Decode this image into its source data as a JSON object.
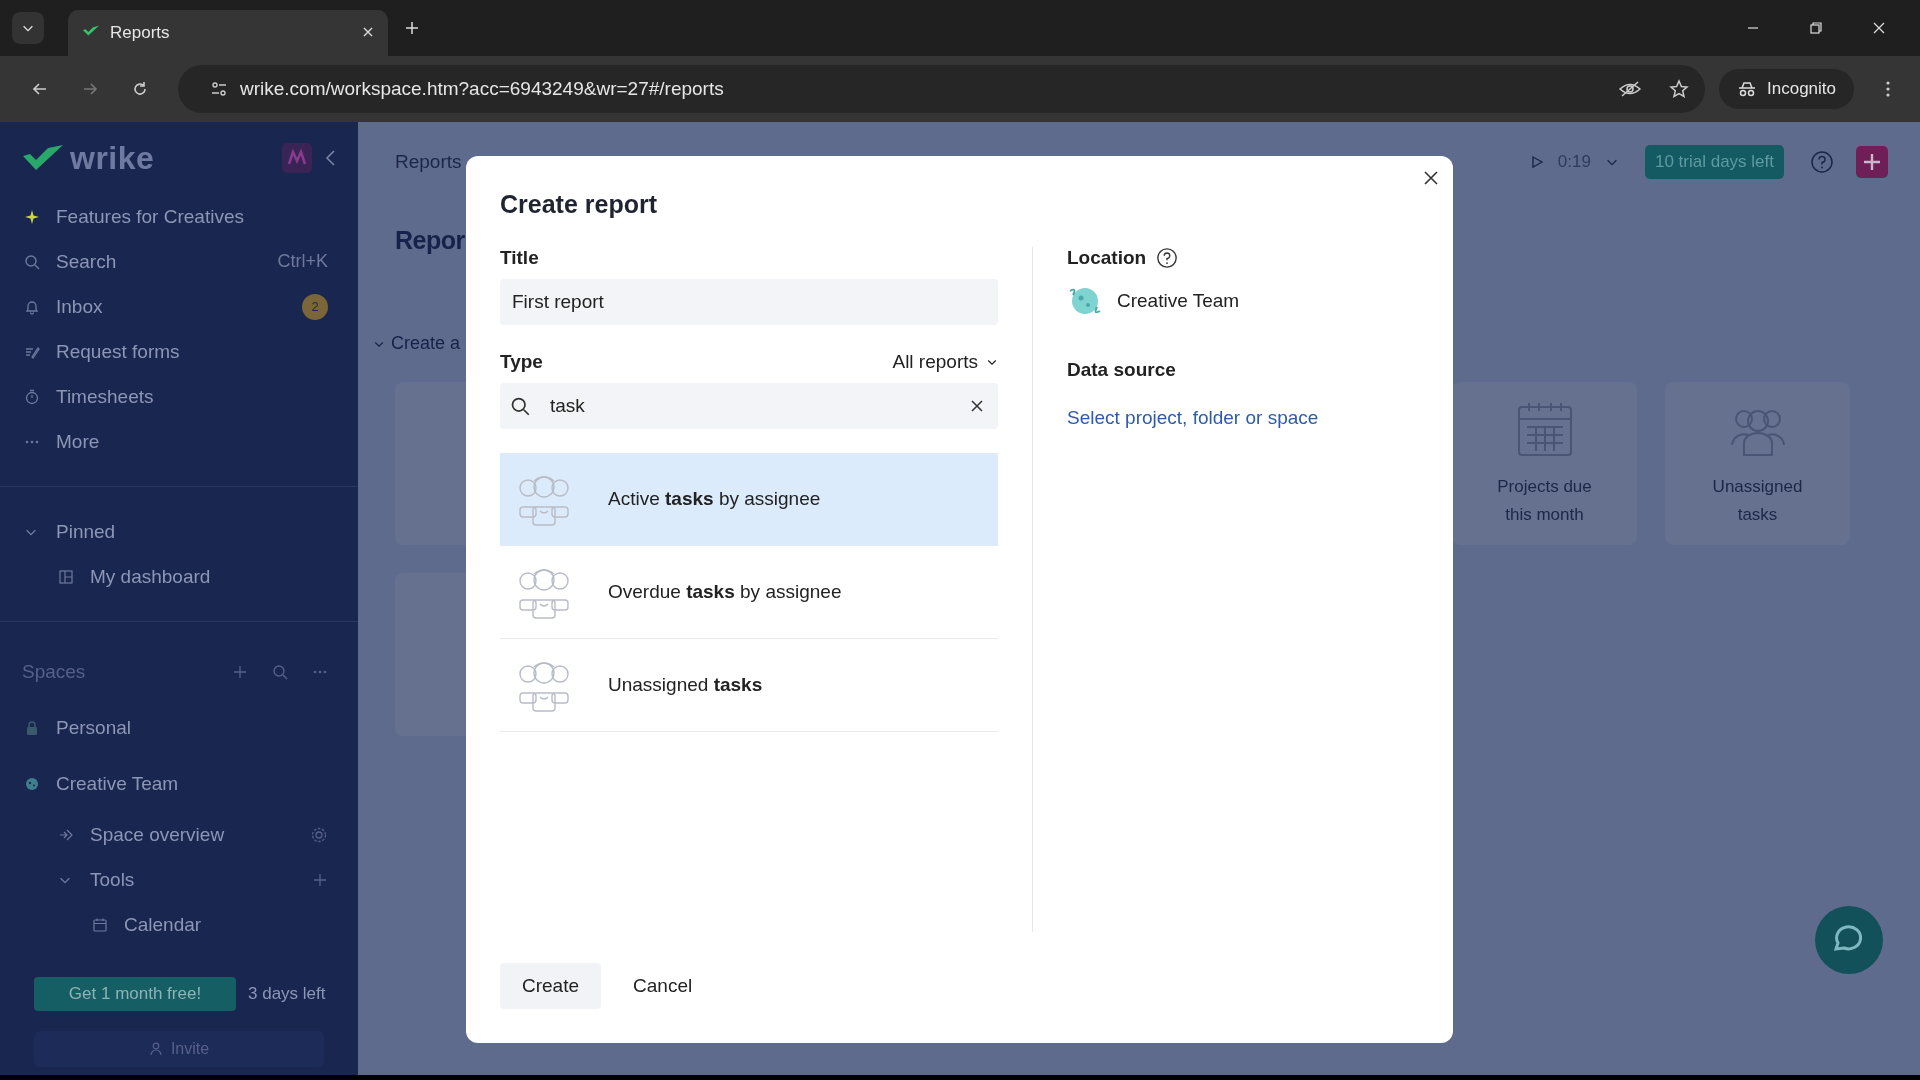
{
  "browser": {
    "tab": {
      "title": "Reports"
    },
    "url": "wrike.com/workspace.htm?acc=6943249&wr=27#/reports",
    "profile": "Incognito"
  },
  "sidebar": {
    "logo": "wrike",
    "nav": [
      {
        "kind": "sparkle",
        "label": "Features for Creatives"
      },
      {
        "kind": "search",
        "label": "Search",
        "shortcut": "Ctrl+K"
      },
      {
        "kind": "bell",
        "label": "Inbox",
        "badge": "2"
      },
      {
        "kind": "form",
        "label": "Request forms"
      },
      {
        "kind": "timer",
        "label": "Timesheets"
      },
      {
        "kind": "dots",
        "label": "More"
      }
    ],
    "pinned": {
      "label": "Pinned",
      "expanded": true,
      "items": [
        {
          "kind": "dashboard",
          "label": "My dashboard"
        }
      ]
    },
    "spaces": {
      "label": "Spaces",
      "items": [
        {
          "kind": "lock",
          "label": "Personal"
        },
        {
          "kind": "planet",
          "label": "Creative Team",
          "children": [
            {
              "kind": "overview",
              "label": "Space overview"
            },
            {
              "kind": "folder",
              "label": "Tools",
              "expanded": true,
              "children": [
                {
                  "kind": "calendar",
                  "label": "Calendar"
                }
              ]
            }
          ]
        }
      ]
    },
    "promo": {
      "button": "Get 1 month free!",
      "note": "3 days left"
    },
    "invite": "Invite"
  },
  "header": {
    "breadcrumb": "Reports",
    "timer": "0:19",
    "trial": "10 trial days left"
  },
  "page": {
    "heading": "Repor",
    "section": "Create a",
    "cards": [
      {
        "kind": "calendar",
        "label": "Projects due this month"
      },
      {
        "kind": "people",
        "label": "Unassigned tasks"
      }
    ]
  },
  "dialog": {
    "title": "Create report",
    "title_label": "Title",
    "title_value": "First report",
    "type_label": "Type",
    "filter": "All reports",
    "search_value": "task",
    "report_types": [
      {
        "label": "Active **tasks** by assignee",
        "selected": true
      },
      {
        "label": "Overdue **tasks** by assignee",
        "selected": false
      },
      {
        "label": "Unassigned **tasks**",
        "selected": false
      }
    ],
    "location_label": "Location",
    "location": "Creative Team",
    "data_source_label": "Data source",
    "data_source_link": "Select project, folder or space",
    "buttons": [
      {
        "label": "Create",
        "kind": "primary"
      },
      {
        "label": "Cancel",
        "kind": "plain"
      }
    ]
  }
}
